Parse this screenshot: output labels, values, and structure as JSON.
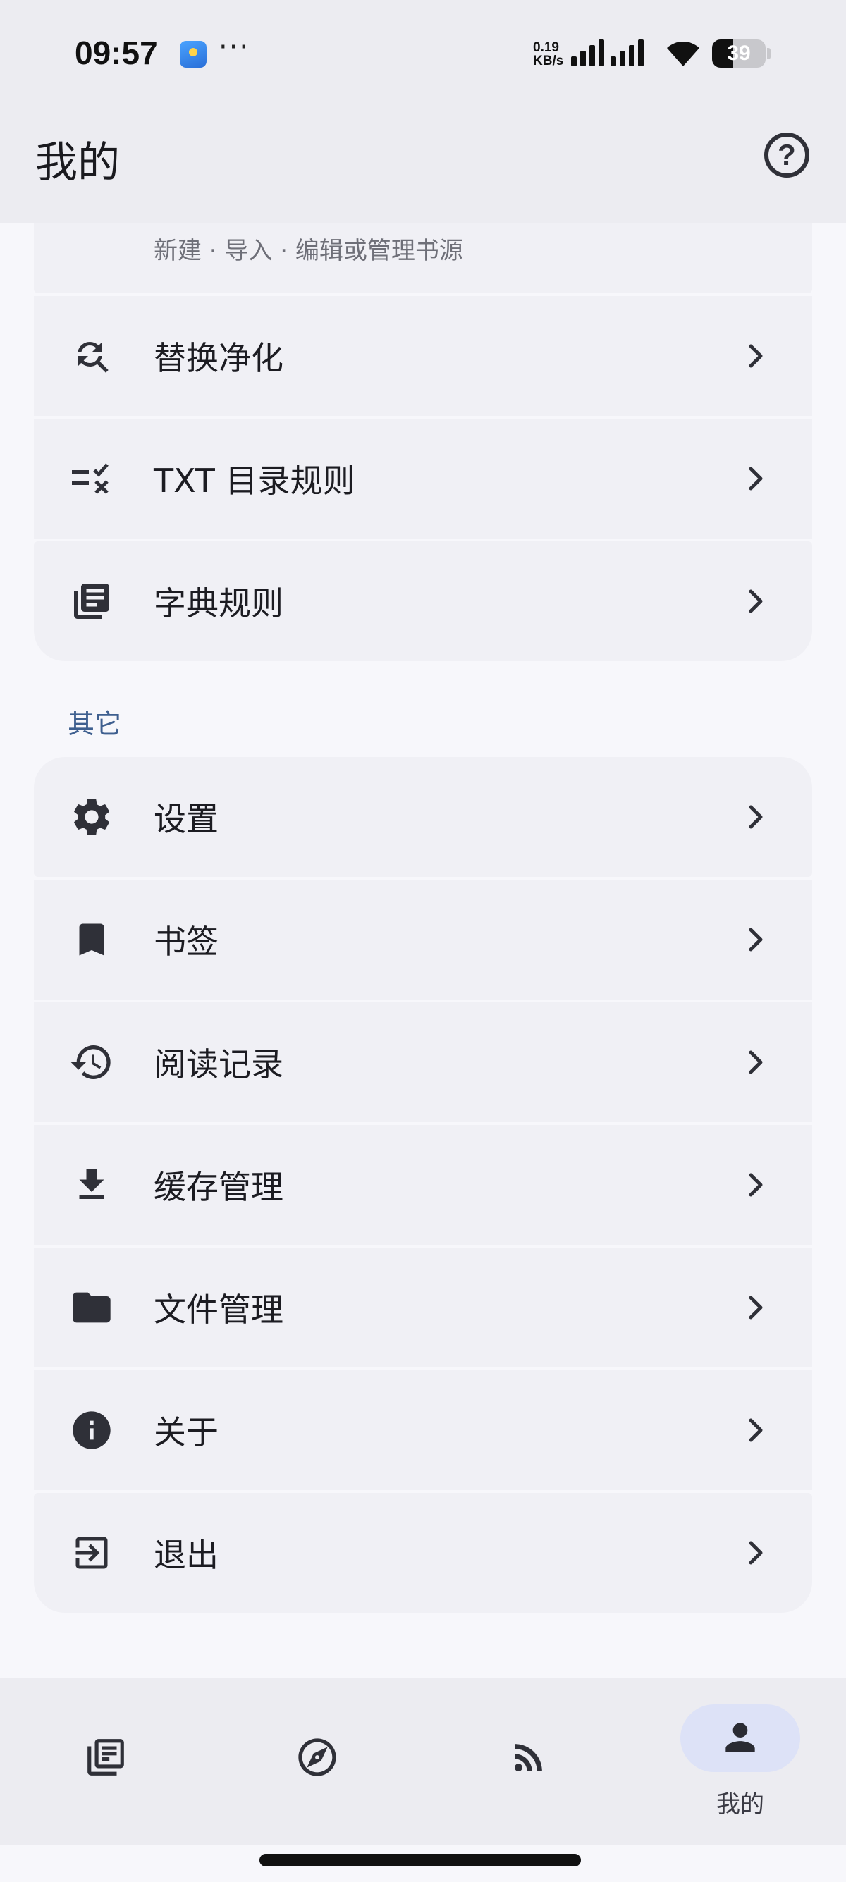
{
  "status": {
    "time": "09:57",
    "more": "···",
    "speed_value": "0.19",
    "speed_unit": "KB/s",
    "battery": "39"
  },
  "app_bar": {
    "title": "我的",
    "help_icon": "help-circle-icon"
  },
  "partial_item": {
    "subtitle": "新建 · 导入 · 编辑或管理书源"
  },
  "rules_group": [
    {
      "label": "替换净化",
      "icon": "find-replace-icon"
    },
    {
      "label": "TXT 目录规则",
      "icon": "toc-rule-icon"
    },
    {
      "label": "字典规则",
      "icon": "dictionary-icon"
    }
  ],
  "other_section": {
    "header": "其它",
    "items": [
      {
        "label": "设置",
        "icon": "gear-icon"
      },
      {
        "label": "书签",
        "icon": "bookmark-icon"
      },
      {
        "label": "阅读记录",
        "icon": "history-icon"
      },
      {
        "label": "缓存管理",
        "icon": "download-icon"
      },
      {
        "label": "文件管理",
        "icon": "folder-icon"
      },
      {
        "label": "关于",
        "icon": "info-icon"
      },
      {
        "label": "退出",
        "icon": "exit-icon"
      }
    ]
  },
  "bottom_nav": {
    "items": [
      {
        "icon": "bookshelf-icon",
        "label": ""
      },
      {
        "icon": "compass-icon",
        "label": ""
      },
      {
        "icon": "rss-icon",
        "label": ""
      },
      {
        "icon": "person-icon",
        "label": "我的",
        "active": true
      }
    ]
  },
  "colors": {
    "background": "#f7f7fb",
    "bar": "#ececf1",
    "row": "#f0f0f5",
    "section_header": "#3e5f8f",
    "active_pill": "#dde2f7",
    "icon": "#2f3038"
  }
}
